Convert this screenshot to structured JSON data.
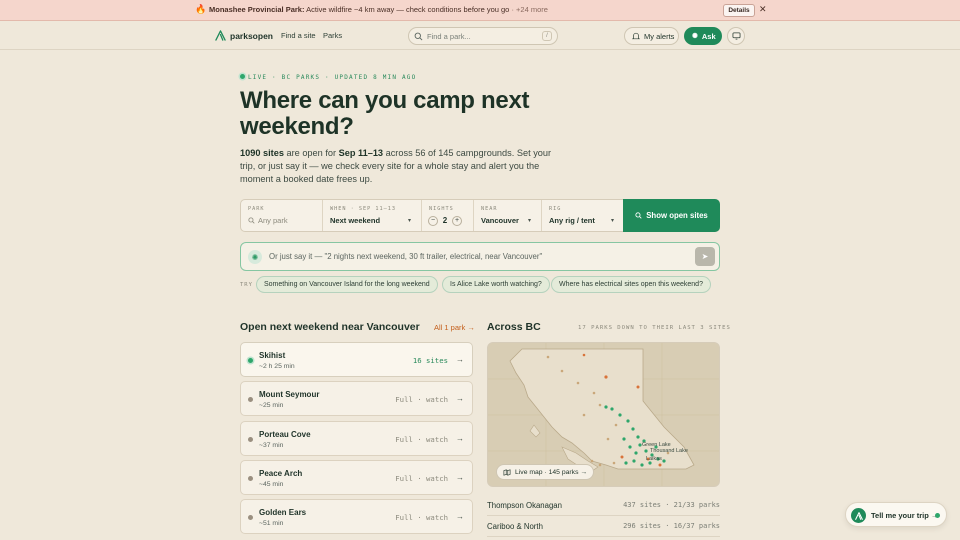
{
  "alert": {
    "title": "Monashee Provincial Park:",
    "message": " Active wildfire ~4 km away — check conditions before you go",
    "more": " · +24 more",
    "details_label": "Details"
  },
  "nav": {
    "brand": "parksopen",
    "links": [
      "Find a site",
      "Parks"
    ],
    "search_placeholder": "Find a park...",
    "search_shortcut": "/",
    "alerts_label": "My alerts",
    "ask_label": "Ask"
  },
  "hero": {
    "live_label": "LIVE · BC PARKS · UPDATED 8 MIN AGO",
    "title": "Where can you camp next weekend?",
    "sub_sites": "1090 sites",
    "sub_mid": " are open for ",
    "sub_dates": "Sep 11–13",
    "sub_rest": " across 56 of 145 campgrounds. Set your trip, or just say it — we check every site for a whole stay and alert you the moment a booked date frees up."
  },
  "form": {
    "park": {
      "label": "PARK",
      "placeholder": "Any park"
    },
    "when": {
      "label": "WHEN · SEP 11–13",
      "value": "Next weekend"
    },
    "nights": {
      "label": "NIGHTS",
      "value": "2"
    },
    "near": {
      "label": "NEAR",
      "value": "Vancouver"
    },
    "rig": {
      "label": "RIG",
      "value": "Any rig / tent"
    },
    "submit_label": "Show open sites"
  },
  "sayit": {
    "placeholder": "Or just say it — \"2 nights next weekend, 30 ft trailer, electrical, near Vancouver\""
  },
  "try": {
    "label": "TRY",
    "chips": [
      "Something on Vancouver Island for the long weekend",
      "Is Alice Lake worth watching?",
      "Where has electrical sites open this weekend?"
    ]
  },
  "open_next": {
    "title": "Open next weekend near Vancouver",
    "all_link": "All 1 park →",
    "camps": [
      {
        "name": "Skihist",
        "time": "~2 h 25 min",
        "status": "16 sites"
      },
      {
        "name": "Mount Seymour",
        "time": "~25 min",
        "status": "Full · watch"
      },
      {
        "name": "Porteau Cove",
        "time": "~37 min",
        "status": "Full · watch"
      },
      {
        "name": "Peace Arch",
        "time": "~45 min",
        "status": "Full · watch"
      },
      {
        "name": "Golden Ears",
        "time": "~51 min",
        "status": "Full · watch"
      }
    ]
  },
  "across": {
    "title": "Across BC",
    "meta": "17 PARKS DOWN TO THEIR LAST 3 SITES",
    "map_pill": "Live map · 145 parks →",
    "map_labels": [
      "Green Lake",
      "Thousand Lake",
      "Laikas"
    ],
    "regions": [
      {
        "name": "Thompson Okanagan",
        "stats": "437 sites · 21/33 parks"
      },
      {
        "name": "Cariboo & North",
        "stats": "296 sites · 16/37 parks"
      }
    ]
  },
  "assistant": {
    "label": "Tell me your trip →"
  },
  "colors": {
    "accent": "#1f8a5a",
    "alert_bg": "#f5d6cc",
    "page_bg": "#efe8da",
    "link_orange": "#c45f1b"
  }
}
